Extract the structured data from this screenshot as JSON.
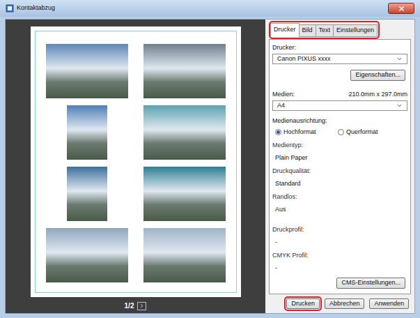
{
  "window": {
    "title": "Kontaktabzug"
  },
  "preview": {
    "page": "1/2",
    "photos": [
      {
        "kind": "landscape",
        "color": "#5f86b8"
      },
      {
        "kind": "landscape",
        "color": "#6f7f8c"
      },
      {
        "kind": "portrait",
        "color": "#4f7fb8"
      },
      {
        "kind": "landscape",
        "color": "#5aa3b0"
      },
      {
        "kind": "portrait",
        "color": "#3f6f9c"
      },
      {
        "kind": "landscape",
        "color": "#2f7f93"
      },
      {
        "kind": "landscape",
        "color": "#8fa6bd"
      },
      {
        "kind": "landscape",
        "color": "#9fb4c8"
      }
    ]
  },
  "tab_bar": {
    "highlighted": true,
    "tabs": [
      {
        "label": "Drucker",
        "selected": true
      },
      {
        "label": "Bild",
        "selected": false
      },
      {
        "label": "Text",
        "selected": false
      },
      {
        "label": "Einstellungen",
        "selected": false
      }
    ]
  },
  "printer": {
    "label": "Drucker:",
    "value": "Canon PIXUS xxxx",
    "properties_button": "Eigenschaften..."
  },
  "media": {
    "label": "Medien:",
    "size": "210.0mm x 297.0mm",
    "value": "A4"
  },
  "orientation": {
    "label": "Medienausrichtung:",
    "options": [
      {
        "label": "Hochformat",
        "selected": true
      },
      {
        "label": "Querformat",
        "selected": false
      }
    ]
  },
  "info": [
    {
      "label": "Medientyp:",
      "value": "Plain Paper"
    },
    {
      "label": "Druckqualität:",
      "value": "Standard"
    },
    {
      "label": "Randlos:",
      "value": "Aus"
    }
  ],
  "profiles": [
    {
      "label": "Druckprofil:",
      "value": "-"
    },
    {
      "label": "CMYK Profil:",
      "value": "-"
    }
  ],
  "cms_button": "CMS-Einstellungen...",
  "buttons": [
    {
      "label": "Drucken",
      "highlighted": true
    },
    {
      "label": "Abbrechen",
      "highlighted": false
    },
    {
      "label": "Anwenden",
      "highlighted": false
    }
  ]
}
